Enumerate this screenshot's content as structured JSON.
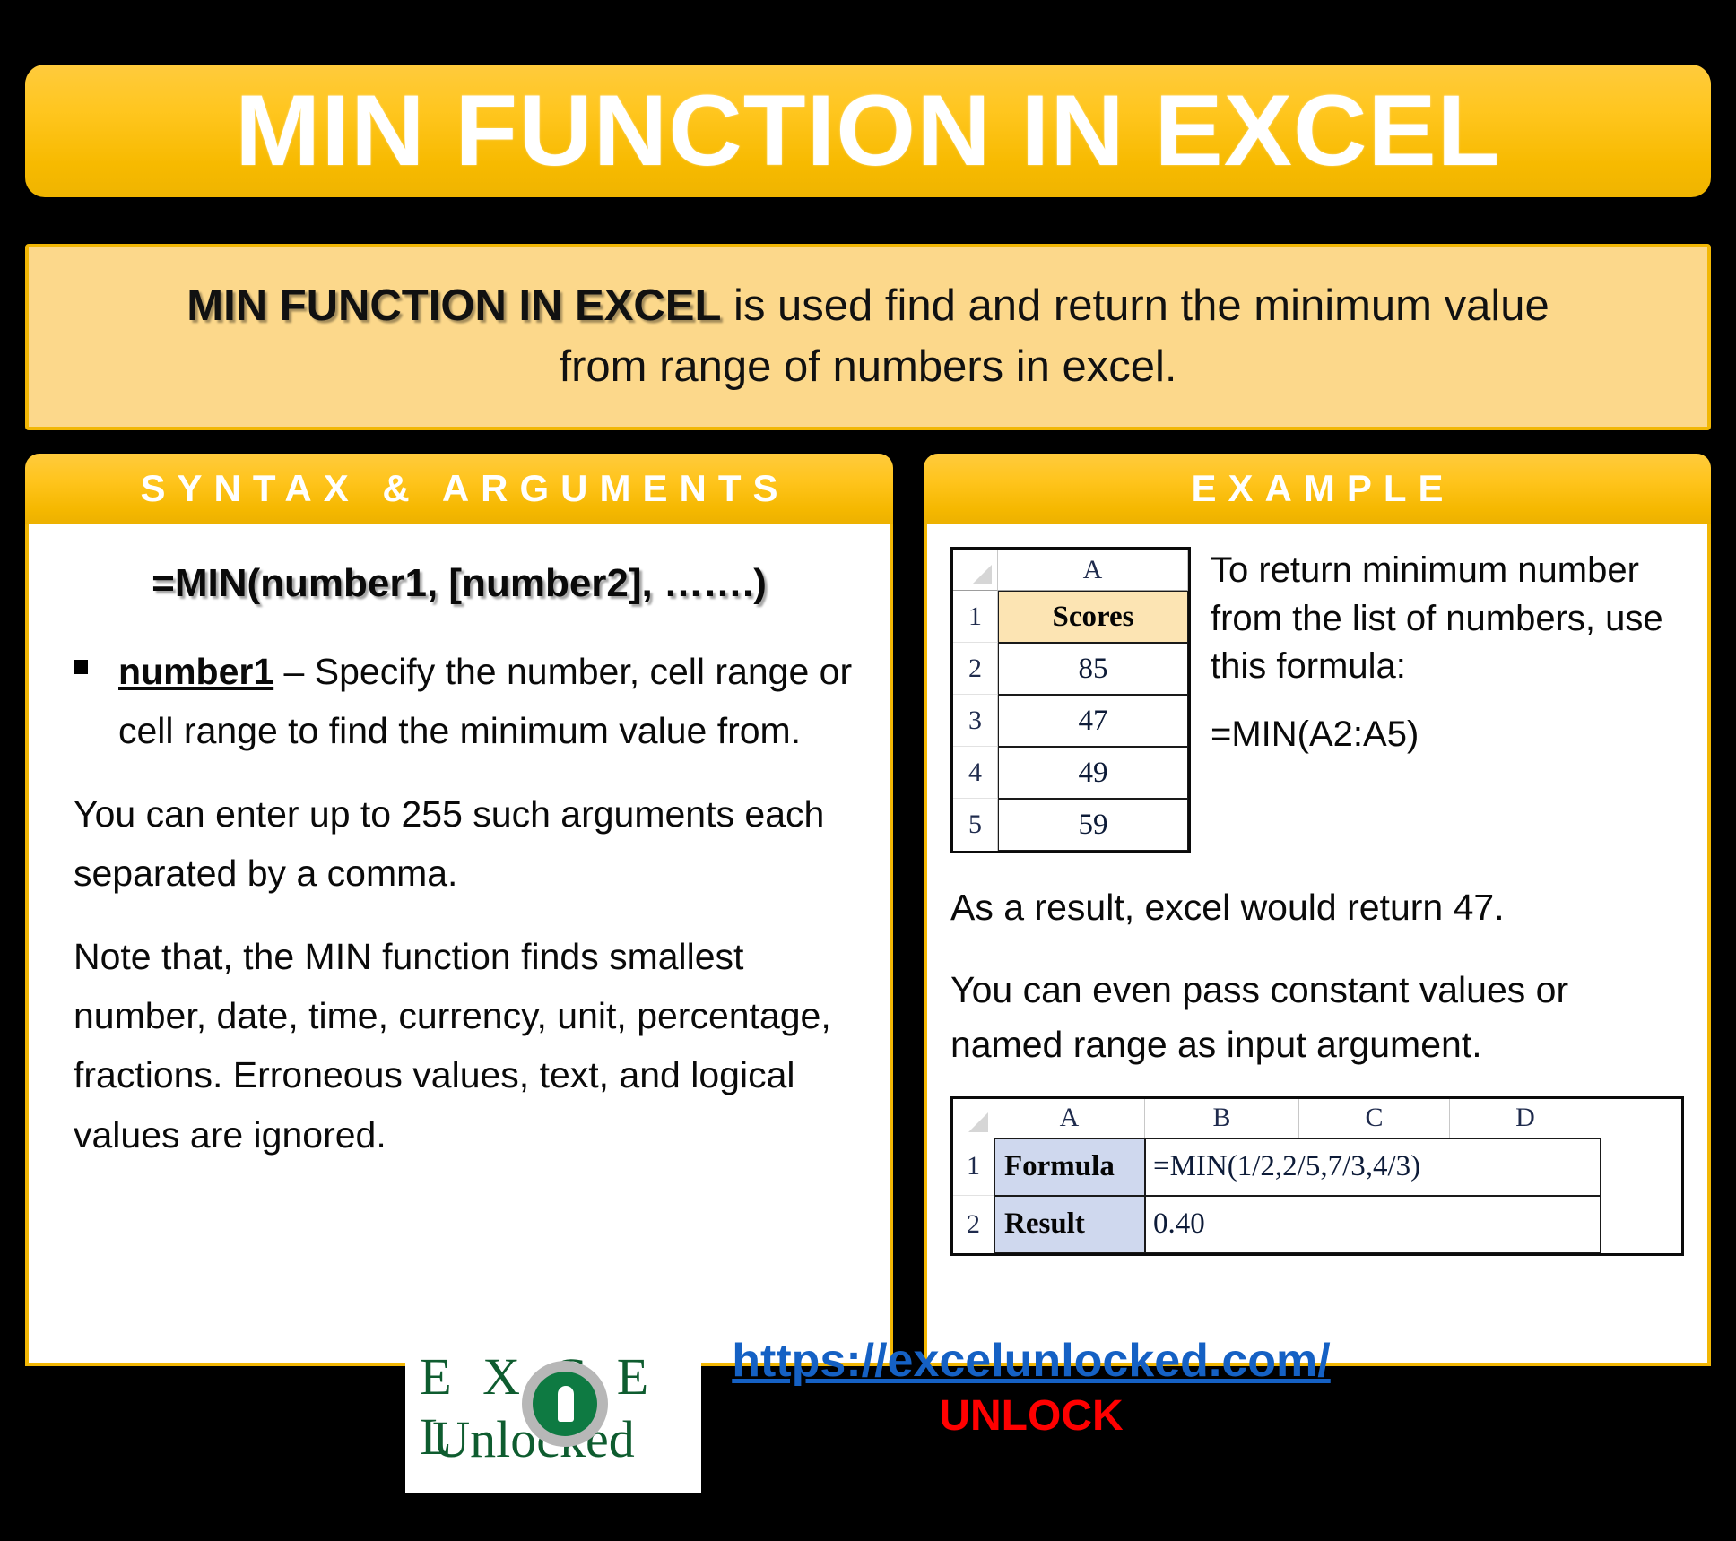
{
  "title": {
    "text": "MIN FUNCTION IN EXCEL"
  },
  "subtitle": {
    "strong": "MIN FUNCTION IN EXCEL",
    "rest": " is used find and return the minimum value",
    "line2": "from range of numbers in excel."
  },
  "syntax_panel": {
    "tab_label": "SYNTAX & ARGUMENTS",
    "formula": "=MIN(number1, [number2], …….)",
    "bullet": {
      "keyword": "number1",
      "rest": " – Specify the number, cell range or cell range to find the minimum value from."
    },
    "para1": "You can enter up to 255 such arguments each separated by a comma.",
    "para2": "Note that, the MIN function finds smallest number, date, time, currency, unit, percentage, fractions. Erroneous values, text, and logical values are ignored."
  },
  "example_panel": {
    "tab_label": "EXAMPLE",
    "scores_sheet": {
      "columns": [
        "A"
      ],
      "rows": [
        {
          "num": "1",
          "cells": [
            "Scores"
          ]
        },
        {
          "num": "2",
          "cells": [
            "85"
          ]
        },
        {
          "num": "3",
          "cells": [
            "47"
          ]
        },
        {
          "num": "4",
          "cells": [
            "49"
          ]
        },
        {
          "num": "5",
          "cells": [
            "59"
          ]
        }
      ]
    },
    "intro_text": "To return minimum number from the list of numbers, use this formula:",
    "formula": "=MIN(A2:A5)",
    "result_text": "As a result, excel would return 47.",
    "constants_text": "You can even pass constant values or named range as input argument.",
    "formula_sheet": {
      "columns": [
        "A",
        "B",
        "C",
        "D"
      ],
      "rows": [
        {
          "num": "1",
          "label": "Formula",
          "value": "=MIN(1/2,2/5,7/3,4/3)"
        },
        {
          "num": "2",
          "label": "Result",
          "value": "0.40"
        }
      ]
    }
  },
  "footer": {
    "logo_excel": "E X C E L",
    "logo_unlocked": "Unlocked",
    "url": "https://excelunlocked.com/",
    "unlock": "UNLOCK"
  },
  "colors": {
    "gold": "#F2B705",
    "gold_light": "#FFCB3D",
    "peach": "#FCD88B",
    "excel_header_fill": "#FCE4B3",
    "excel_label_fill": "#CFD8EE",
    "link_blue": "#1561C4",
    "unlock_red": "#FF0000",
    "logo_green": "#0E5C2F",
    "background": "#000000"
  }
}
